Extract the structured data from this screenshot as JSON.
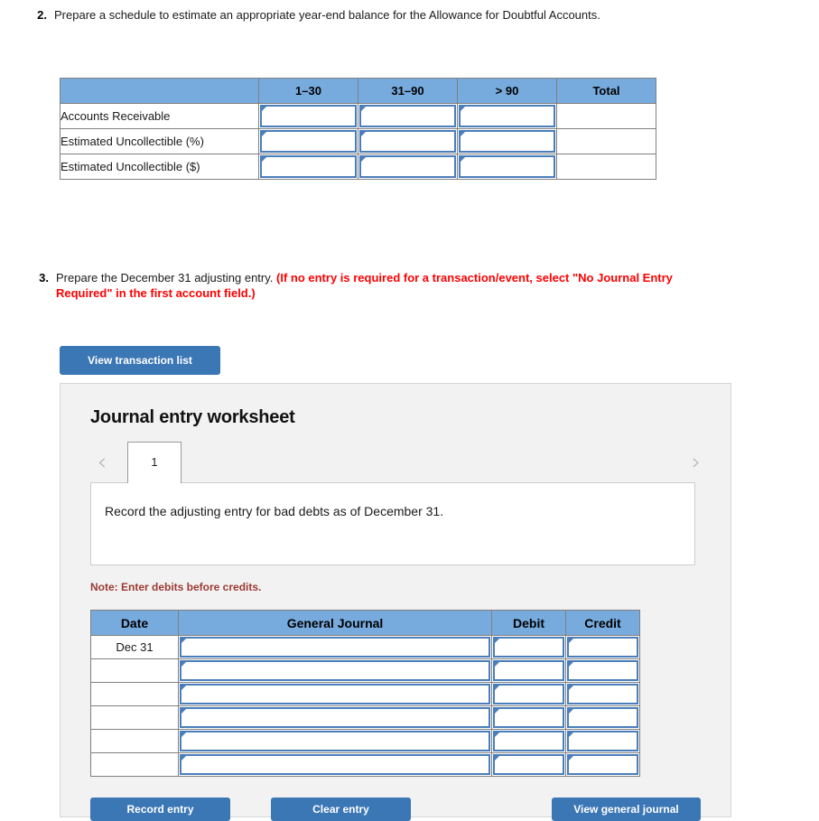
{
  "question2": {
    "number": "2.",
    "text": "Prepare a schedule to estimate an appropriate year-end balance for the Allowance for Doubtful Accounts."
  },
  "question3": {
    "number": "3.",
    "text_plain": "Prepare the December 31 adjusting entry. ",
    "text_red": "(If no entry is required for a transaction/event, select \"No Journal Entry Required\" in the first account field.)"
  },
  "aging_table": {
    "headers": [
      "",
      "1–30",
      "31–90",
      "> 90",
      "Total"
    ],
    "rows": [
      {
        "label": "Accounts Receivable",
        "band1": "",
        "band2": "",
        "band3": "",
        "total": ""
      },
      {
        "label": "Estimated Uncollectible (%)",
        "band1": "",
        "band2": "",
        "band3": "",
        "total": ""
      },
      {
        "label": "Estimated Uncollectible ($)",
        "band1": "",
        "band2": "",
        "band3": "",
        "total": ""
      }
    ]
  },
  "buttons": {
    "view_transaction_list": "View transaction list",
    "record_entry": "Record entry",
    "clear_entry": "Clear entry",
    "view_general_journal": "View general journal"
  },
  "worksheet": {
    "title": "Journal entry worksheet",
    "prev_arrow": "‹",
    "next_arrow": "›",
    "tabs": [
      {
        "label": "1",
        "active": true
      }
    ],
    "instruction": "Record the adjusting entry for bad debts as of December 31.",
    "note": "Note: Enter debits before credits."
  },
  "journal_table": {
    "headers": [
      "Date",
      "General Journal",
      "Debit",
      "Credit"
    ],
    "rows": [
      {
        "date": "Dec 31",
        "journal": "",
        "debit": "",
        "credit": ""
      },
      {
        "date": "",
        "journal": "",
        "debit": "",
        "credit": ""
      },
      {
        "date": "",
        "journal": "",
        "debit": "",
        "credit": ""
      },
      {
        "date": "",
        "journal": "",
        "debit": "",
        "credit": ""
      },
      {
        "date": "",
        "journal": "",
        "debit": "",
        "credit": ""
      },
      {
        "date": "",
        "journal": "",
        "debit": "",
        "credit": ""
      }
    ]
  },
  "colors": {
    "header_blue": "#77aadd",
    "button_blue": "#3b76b5",
    "input_border_blue": "#4a7ebb",
    "note_red": "#9c3a33",
    "alert_red": "#ff0000",
    "panel_gray": "#f2f2f2"
  }
}
